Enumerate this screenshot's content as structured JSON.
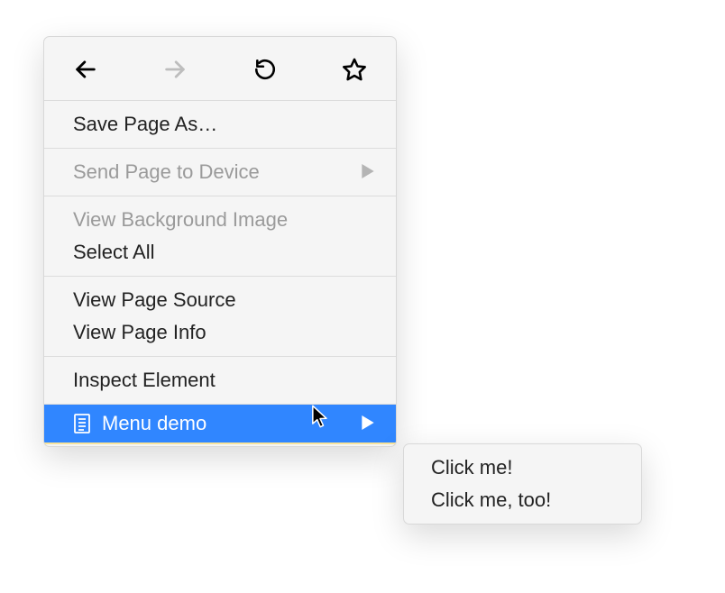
{
  "menu": {
    "save_page_as": "Save Page As…",
    "send_page_to_device": "Send Page to Device",
    "view_background_image": "View Background Image",
    "select_all": "Select All",
    "view_page_source": "View Page Source",
    "view_page_info": "View Page Info",
    "inspect_element": "Inspect Element",
    "menu_demo": "Menu demo"
  },
  "submenu": {
    "click_me": "Click me!",
    "click_me_too": "Click me, too!"
  },
  "colors": {
    "highlight": "#3086ff",
    "disabled": "#9a9a9a",
    "menu_bg": "#f5f5f5",
    "border": "#d8d8d8"
  },
  "icons": {
    "back": "back-arrow-icon",
    "forward": "forward-arrow-icon",
    "reload": "reload-icon",
    "bookmark": "star-icon",
    "page": "page-icon",
    "submenu_arrow": "chevron-right-icon",
    "cursor": "cursor-icon"
  }
}
